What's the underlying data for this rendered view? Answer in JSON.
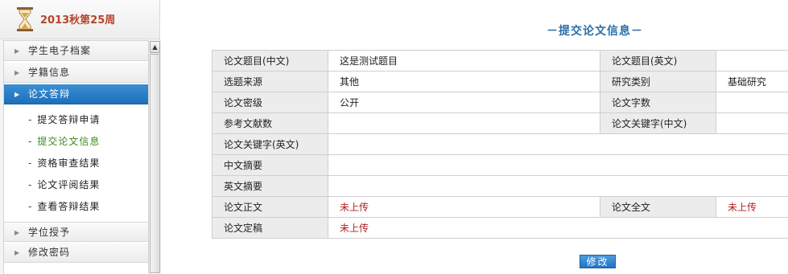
{
  "sidebar": {
    "term_title": "2013秋第25周",
    "menu": [
      {
        "label": "学生电子档案"
      },
      {
        "label": "学籍信息"
      },
      {
        "label": "论文答辩"
      },
      {
        "label": "学位授予"
      },
      {
        "label": "修改密码"
      }
    ],
    "submenu": [
      {
        "label": "提交答辩申请"
      },
      {
        "label": "提交论文信息"
      },
      {
        "label": "资格审查结果"
      },
      {
        "label": "论文评阅结果"
      },
      {
        "label": "查看答辩结果"
      }
    ],
    "active_menu": "论文答辩",
    "current_submenu": "提交论文信息"
  },
  "main": {
    "heading": "－提交论文信息－",
    "rows": [
      {
        "l1": "论文题目(中文)",
        "v1": "这是测试题目",
        "l2": "论文题目(英文)",
        "v2": ""
      },
      {
        "l1": "选题来源",
        "v1": "其他",
        "l2": "研究类别",
        "v2": "基础研究"
      },
      {
        "l1": "论文密级",
        "v1": "公开",
        "l2": "论文字数",
        "v2": ""
      },
      {
        "l1": "参考文献数",
        "v1": "",
        "l2": "论文关键字(中文)",
        "v2": ""
      },
      {
        "l1": "论文关键字(英文)",
        "v1": ""
      },
      {
        "l1": "中文摘要",
        "v1": ""
      },
      {
        "l1": "英文摘要",
        "v1": ""
      },
      {
        "l1": "论文正文",
        "v1": "未上传",
        "l2": "论文全文",
        "v2": "未上传"
      },
      {
        "l1": "论文定稿",
        "v1": "未上传"
      }
    ],
    "edit_label": "修改"
  },
  "colors": {
    "accent": "#2a6fa8",
    "active_menu": "#1e6fb8",
    "current_submenu": "#3b8a1e",
    "status_red": "#b32020",
    "term_title": "#b3452a"
  }
}
